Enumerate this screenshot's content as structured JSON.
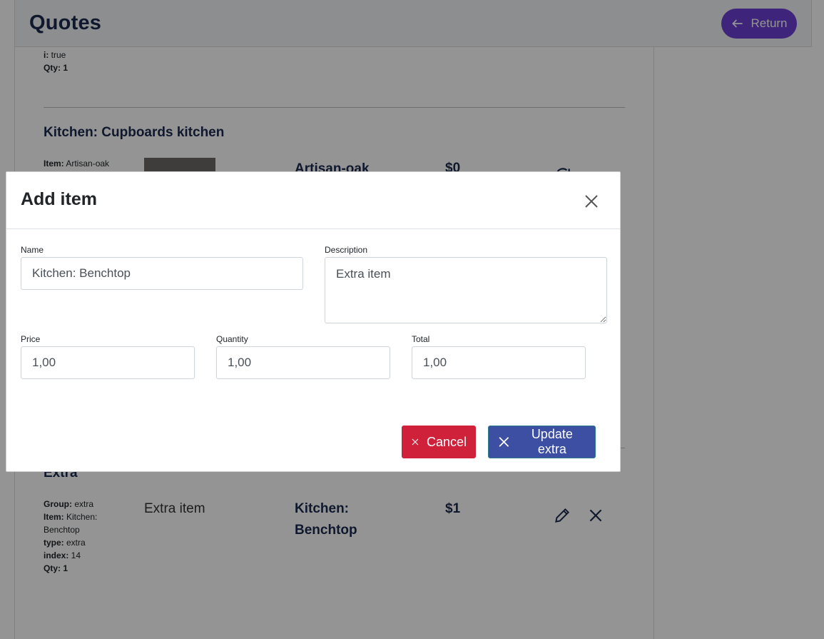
{
  "header": {
    "title": "Quotes",
    "return_label": "Return"
  },
  "items": {
    "first_meta": {
      "i_key": "i:",
      "i_val": " true",
      "qty_key": "Qty:",
      "qty_val": " 1"
    },
    "kitchen_section": {
      "title": "Kitchen: Cupboards kitchen",
      "item_key": "Item:",
      "item_val": " Artisan-oak",
      "name": "Artisan-oak",
      "price": "$0"
    },
    "extra_section": {
      "title": "Extra",
      "group_key": "Group:",
      "group_val": " extra",
      "item_key": "Item:",
      "item_val": " Kitchen: Benchtop",
      "type_key": "type:",
      "type_val": " extra",
      "index_key": "index:",
      "index_val": " 14",
      "qty_key": "Qty:",
      "qty_val": " 1",
      "description": "Extra item",
      "name_line1": "Kitchen:",
      "name_line2": "Benchtop",
      "price": "$1"
    }
  },
  "modal": {
    "title": "Add item",
    "name_label": "Name",
    "name_value": "Kitchen: Benchtop",
    "description_label": "Description",
    "description_value": "Extra item",
    "price_label": "Price",
    "price_value": "1,00",
    "quantity_label": "Quantity",
    "quantity_value": "1,00",
    "total_label": "Total",
    "total_value": "1,00",
    "cancel_label": "Cancel",
    "update_label": "Update extra"
  },
  "colors": {
    "accent": "#6b3fd4",
    "danger": "#d0213a",
    "primary": "#3c4fa3",
    "heading": "#1a2a4f"
  },
  "icons": [
    "arrow-left-icon",
    "refresh-icon",
    "pencil-icon",
    "close-icon"
  ]
}
